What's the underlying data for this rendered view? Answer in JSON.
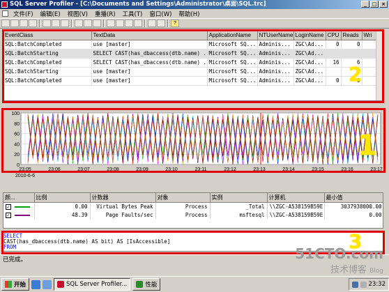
{
  "window": {
    "title": "SQL Server Profiler - [C:\\Documents and Settings\\Administrator\\桌面\\SQL.trc]"
  },
  "menu": [
    "文件(F)",
    "编辑(E)",
    "视图(V)",
    "重播(R)",
    "工具(T)",
    "窗口(W)",
    "帮助(H)"
  ],
  "trace": {
    "columns": [
      "EventClass",
      "TextData",
      "ApplicationName",
      "NTUserName",
      "LoginName",
      "CPU",
      "Reads",
      "Wri"
    ],
    "rows": [
      [
        "SQL:BatchCompleted",
        "use [master]",
        "Microsoft SQ...",
        "Adminis...",
        "ZGC\\Ad...",
        "0",
        "0",
        ""
      ],
      [
        "SQL:BatchStarting",
        "SELECT CAST(has_dbaccess(dtb.name) ...",
        "Microsoft SQ...",
        "Adminis...",
        "ZGC\\Ad...",
        "",
        "",
        ""
      ],
      [
        "SQL:BatchCompleted",
        "SELECT CAST(has_dbaccess(dtb.name) ...",
        "Microsoft SQ...",
        "Adminis...",
        "ZGC\\Ad...",
        "16",
        "6",
        ""
      ],
      [
        "SQL:BatchStarting",
        "use [master]",
        "Microsoft SQ...",
        "Adminis...",
        "ZGC\\Ad...",
        "",
        "",
        ""
      ],
      [
        "SQL:BatchCompleted",
        "use [master]",
        "Microsoft SQ...",
        "Adminis...",
        "ZGC\\Ad...",
        "0",
        "0",
        ""
      ]
    ]
  },
  "chart_data": {
    "type": "line",
    "x": [
      "23:05",
      "23:06",
      "23:07",
      "23:08",
      "23:09",
      "23:10",
      "23:11",
      "23:12",
      "23:13",
      "23:14",
      "23:15",
      "23:16",
      "23:17"
    ],
    "date_label": "2010-6-6",
    "ylim": [
      0,
      100
    ],
    "yticks": [
      0,
      20,
      40,
      60,
      80,
      100
    ],
    "grid": true,
    "colors": [
      "#ff0000",
      "#0000ff",
      "#00a000",
      "#ff00ff",
      "#8000ff",
      "#00c0c0",
      "#c0a000",
      "#000080",
      "#800000",
      "#ff8000"
    ]
  },
  "counters": {
    "columns": [
      "颜...",
      "比例",
      "计数器",
      "对象",
      "实例",
      "计算机",
      "最小值"
    ],
    "rows": [
      {
        "checked": true,
        "color": "#00a000",
        "scale": "0.00",
        "counter": "Virtual Bytes Peak",
        "object": "Process",
        "instance": "_Total",
        "computer": "\\\\ZGC-A538159B59E",
        "min": "3037938000.00"
      },
      {
        "checked": true,
        "color": "#800080",
        "scale": "48.39",
        "counter": "Page Faults/sec",
        "object": "Process",
        "instance": "msftesql",
        "computer": "\\\\ZGC-A538159B59E",
        "min": "0.00"
      }
    ]
  },
  "sql_text": {
    "line1": "SELECT",
    "line2": "CAST(has_dbaccess(dtb.name) AS bit) AS [IsAccessible]",
    "line3": "FROM"
  },
  "status": "已完成。",
  "annotations": {
    "badge1": "1",
    "badge2": "2",
    "badge3": "3"
  },
  "taskbar": {
    "start": "开始",
    "items": [
      "SQL Server Profiler...",
      "性能"
    ],
    "clock": "23:32"
  },
  "watermark": {
    "site": "51CTO.com",
    "line2": "技术博客",
    "blog": "Blog"
  }
}
